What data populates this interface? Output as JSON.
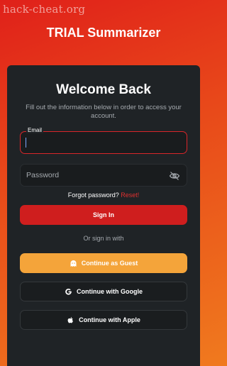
{
  "watermark": "hack-cheat.org",
  "app_title": "TRIAL Summarizer",
  "card": {
    "title": "Welcome Back",
    "subtitle": "Fill out the information below in order to access your account.",
    "email_label": "Email",
    "email_value": "",
    "password_placeholder": "Password",
    "forgot_text": "Forgot password?",
    "reset_text": "Reset!",
    "sign_in_label": "Sign In",
    "or_text": "Or sign in with",
    "guest_label": "Continue as Guest",
    "google_label": "Continue with Google",
    "apple_label": "Continue with Apple"
  },
  "icons": {
    "password_toggle": "eye-off-icon",
    "guest": "ghost-icon",
    "google": "google-icon",
    "apple": "apple-icon"
  },
  "colors": {
    "accent_red": "#cf1e1e",
    "guest_orange": "#f4a43a",
    "card_bg": "#1f2326"
  }
}
